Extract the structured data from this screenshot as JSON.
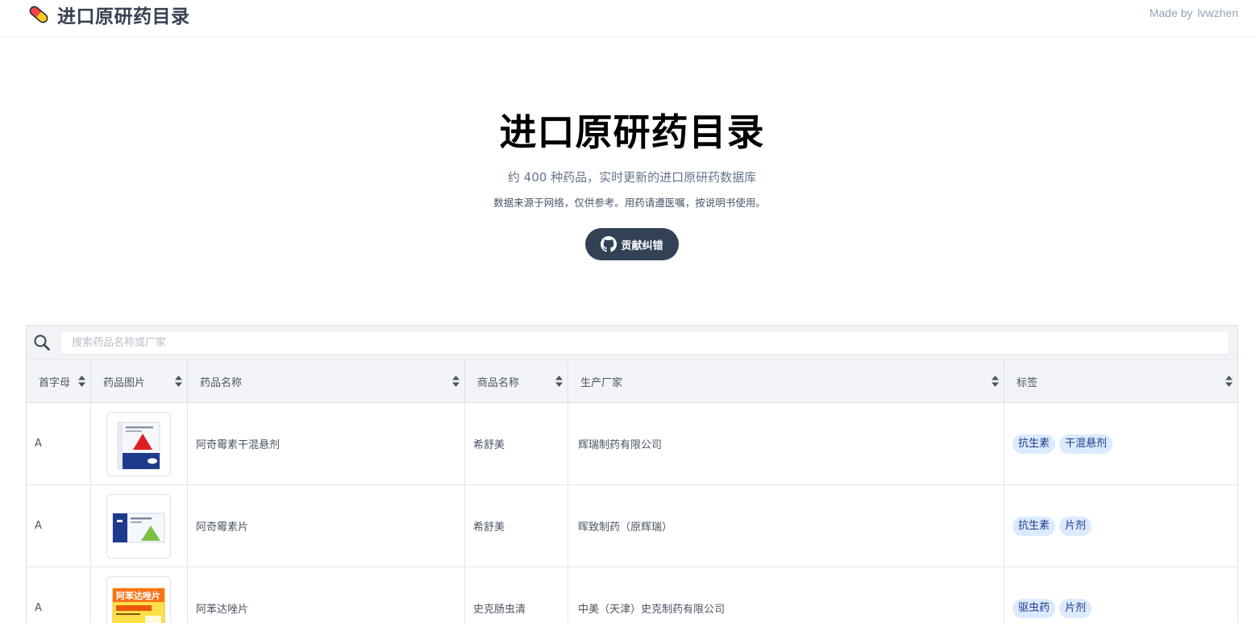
{
  "header": {
    "title": "进口原研药目录",
    "made_by_label": "Made by",
    "author": "lvwzhen"
  },
  "hero": {
    "title": "进口原研药目录",
    "subtitle": "约 400 种药品，实时更新的进口原研药数据库",
    "note": "数据来源于网络，仅供参考。用药请遵医嘱，按说明书使用。",
    "contribute_label": "贡献纠错"
  },
  "search": {
    "placeholder": "搜索药品名称或厂家",
    "value": ""
  },
  "table": {
    "columns": [
      "首字母",
      "药品图片",
      "药品名称",
      "商品名称",
      "生产厂家",
      "标签"
    ],
    "rows": [
      {
        "letter": "A",
        "image": "azithromycin-suspension-box",
        "name": "阿奇霉素干混悬剂",
        "brand": "希舒美",
        "maker": "辉瑞制药有限公司",
        "tags": [
          "抗生素",
          "干混悬剂"
        ]
      },
      {
        "letter": "A",
        "image": "azithromycin-tablet-box",
        "name": "阿奇霉素片",
        "brand": "希舒美",
        "maker": "晖致制药（原辉瑞）",
        "tags": [
          "抗生素",
          "片剂"
        ]
      },
      {
        "letter": "A",
        "image": "albendazole-tablet-box",
        "name": "阿苯达唑片",
        "brand": "史克肠虫清",
        "maker": "中美（天津）史克制药有限公司",
        "tags": [
          "驱虫药",
          "片剂"
        ],
        "box_text": "阿苯达唑片"
      }
    ]
  },
  "colors": {
    "tag_bg": "#dbeafe",
    "tag_text": "#1e3a8a",
    "button_bg": "#334155",
    "header_bg": "#f3f4f7"
  }
}
